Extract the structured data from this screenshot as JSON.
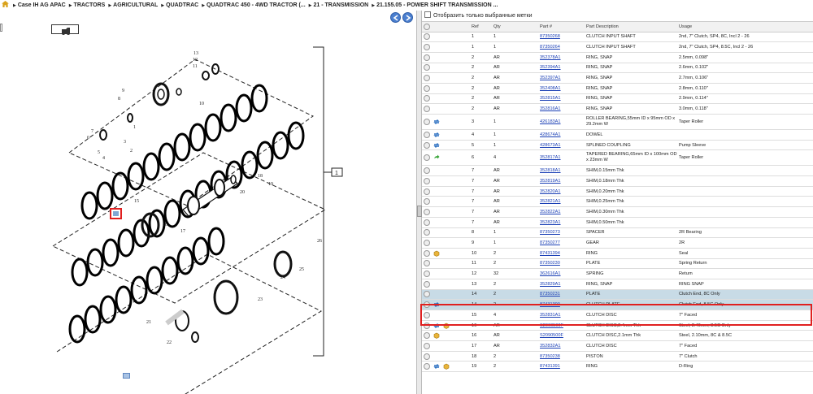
{
  "breadcrumb": {
    "items": [
      "Case IH AG APAC",
      "TRACTORS",
      "AGRICULTURAL",
      "QUADTRAC",
      "QUADTRAC 450 - 4WD TRACTOR (...",
      "21 - TRANSMISSION",
      "21.155.05 - POWER SHIFT TRANSMISSION ..."
    ]
  },
  "filter": {
    "label": "Отобразить только выбранные метки"
  },
  "table": {
    "headers": [
      "Ref",
      "Qty",
      "Part #",
      "Part Description",
      "Usage"
    ],
    "rows": [
      {
        "ref": "1",
        "qty": "1",
        "part": "87350268",
        "desc": "CLUTCH INPUT SHAFT",
        "usage": "2nd, 7\" Clutch, SP4, 8C, Incl 2 - 26",
        "icons": []
      },
      {
        "ref": "1",
        "qty": "1",
        "part": "87350264",
        "desc": "CLUTCH INPUT SHAFT",
        "usage": "2nd, 7\" Clutch, SP4, 8.5C, Incl 2 - 26",
        "icons": []
      },
      {
        "ref": "2",
        "qty": "AR",
        "part": "352378A1",
        "desc": "RING, SNAP",
        "usage": "2.5mm, 0.098\"",
        "icons": []
      },
      {
        "ref": "2",
        "qty": "AR",
        "part": "352394A1",
        "desc": "RING, SNAP",
        "usage": "2.6mm, 0.102\"",
        "icons": []
      },
      {
        "ref": "2",
        "qty": "AR",
        "part": "352397A1",
        "desc": "RING, SNAP",
        "usage": "2.7mm, 0.106\"",
        "icons": []
      },
      {
        "ref": "2",
        "qty": "AR",
        "part": "352408A1",
        "desc": "RING, SNAP",
        "usage": "2.8mm, 0.110\"",
        "icons": []
      },
      {
        "ref": "2",
        "qty": "AR",
        "part": "352815A1",
        "desc": "RING, SNAP",
        "usage": "2.9mm, 0.114\"",
        "icons": []
      },
      {
        "ref": "2",
        "qty": "AR",
        "part": "352816A1",
        "desc": "RING, SNAP",
        "usage": "3.0mm, 0.118\"",
        "icons": []
      },
      {
        "ref": "3",
        "qty": "1",
        "part": "426183A1",
        "desc": "ROLLER BEARING,55mm ID x 95mm OD x 29.2mm W",
        "usage": "Taper Roller",
        "icons": [
          "swap"
        ],
        "tall": true
      },
      {
        "ref": "4",
        "qty": "1",
        "part": "428674A1",
        "desc": "DOWEL",
        "usage": "",
        "icons": [
          "swap"
        ]
      },
      {
        "ref": "5",
        "qty": "1",
        "part": "428673A1",
        "desc": "SPLINED COUPLING",
        "usage": "Pump Sleeve",
        "icons": [
          "swap"
        ]
      },
      {
        "ref": "6",
        "qty": "4",
        "part": "352817A1",
        "desc": "TAPERED BEARING,65mm ID x 100mm OD x 23mm W",
        "usage": "Taper Roller",
        "icons": [
          "arrow"
        ],
        "tall": true
      },
      {
        "ref": "7",
        "qty": "AR",
        "part": "352818A1",
        "desc": "SHIM,0.15mm Thk",
        "usage": "",
        "icons": []
      },
      {
        "ref": "7",
        "qty": "AR",
        "part": "352819A1",
        "desc": "SHIM,0.18mm Thk",
        "usage": "",
        "icons": []
      },
      {
        "ref": "7",
        "qty": "AR",
        "part": "352820A1",
        "desc": "SHIM,0.20mm Thk",
        "usage": "",
        "icons": []
      },
      {
        "ref": "7",
        "qty": "AR",
        "part": "352821A1",
        "desc": "SHIM,0.25mm Thk",
        "usage": "",
        "icons": []
      },
      {
        "ref": "7",
        "qty": "AR",
        "part": "352822A1",
        "desc": "SHIM,0.30mm Thk",
        "usage": "",
        "icons": []
      },
      {
        "ref": "7",
        "qty": "AR",
        "part": "352823A1",
        "desc": "SHIM,0.50mm Thk",
        "usage": "",
        "icons": []
      },
      {
        "ref": "8",
        "qty": "1",
        "part": "87350273",
        "desc": "SPACER",
        "usage": "2R Bearing",
        "icons": []
      },
      {
        "ref": "9",
        "qty": "1",
        "part": "87350277",
        "desc": "GEAR",
        "usage": "2R",
        "icons": []
      },
      {
        "ref": "10",
        "qty": "2",
        "part": "87431394",
        "desc": "RING",
        "usage": "Seal",
        "icons": [
          "box"
        ]
      },
      {
        "ref": "11",
        "qty": "2",
        "part": "87350230",
        "desc": "PLATE",
        "usage": "Spring Return",
        "icons": []
      },
      {
        "ref": "12",
        "qty": "32",
        "part": "362616A1",
        "desc": "SPRING",
        "usage": "Return",
        "icons": []
      },
      {
        "ref": "13",
        "qty": "2",
        "part": "352829A1",
        "desc": "RING, SNAP",
        "usage": "RING SNAP",
        "icons": []
      },
      {
        "ref": "14",
        "qty": "2",
        "part": "87350231",
        "desc": "PLATE",
        "usage": "Clutch End, 8C Only",
        "icons": [],
        "sel": true
      },
      {
        "ref": "14",
        "qty": "2",
        "part": "87431390",
        "desc": "CLUTCH PLATE",
        "usage": "Clutch End, 8.5C Only",
        "icons": [
          "swap"
        ],
        "sel": true
      },
      {
        "ref": "15",
        "qty": "4",
        "part": "352831A1",
        "desc": "CLUTCH DISC",
        "usage": "7\" Faced",
        "icons": []
      },
      {
        "ref": "16",
        "qty": "AR",
        "part": "S2060500F",
        "desc": "CLUTCH DISC,2.4mm Thk",
        "usage": "Steel, 2.40mm, 8.5C Only",
        "icons": [
          "swap",
          "box"
        ]
      },
      {
        "ref": "16",
        "qty": "AR",
        "part": "S2090500F",
        "desc": "CLUTCH DISC,2.1mm Thk",
        "usage": "Steel, 2.10mm, 8C & 8.5C",
        "icons": [
          "box"
        ]
      },
      {
        "ref": "17",
        "qty": "AR",
        "part": "352832A1",
        "desc": "CLUTCH DISC",
        "usage": "7\" Faced",
        "icons": []
      },
      {
        "ref": "18",
        "qty": "2",
        "part": "87350238",
        "desc": "PISTON",
        "usage": "7\" Clutch",
        "icons": []
      },
      {
        "ref": "19",
        "qty": "2",
        "part": "87431391",
        "desc": "RING",
        "usage": "D-Ring",
        "icons": [
          "swap",
          "box"
        ]
      }
    ]
  },
  "diagram": {
    "callout_main": "1",
    "labels": [
      "13",
      "12",
      "11",
      "10",
      "9",
      "8",
      "7",
      "6",
      "5",
      "4",
      "3",
      "2",
      "1",
      "15",
      "16",
      "17",
      "18",
      "19",
      "20",
      "21",
      "22",
      "23",
      "24",
      "25",
      "26"
    ]
  }
}
